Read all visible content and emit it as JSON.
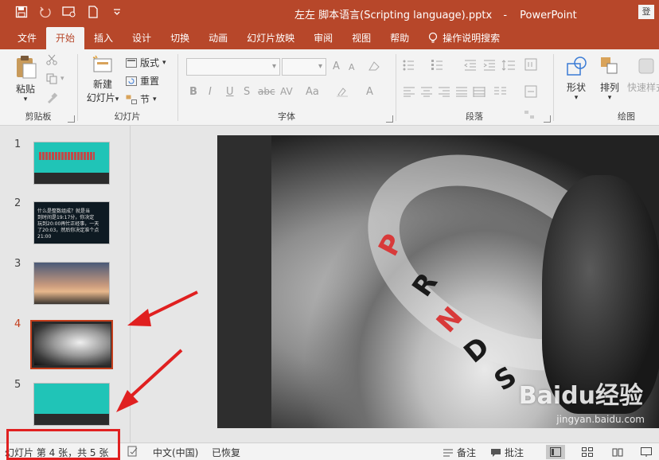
{
  "titlebar": {
    "document": "左左 脚本语言(Scripting language).pptx",
    "separator": "-",
    "app": "PowerPoint",
    "login": "登"
  },
  "qat": [
    "save-icon",
    "undo-icon",
    "presentation-icon",
    "new-file-icon",
    "customize-icon"
  ],
  "tabs": [
    {
      "label": "文件",
      "active": false
    },
    {
      "label": "开始",
      "active": true
    },
    {
      "label": "插入",
      "active": false
    },
    {
      "label": "设计",
      "active": false
    },
    {
      "label": "切换",
      "active": false
    },
    {
      "label": "动画",
      "active": false
    },
    {
      "label": "幻灯片放映",
      "active": false
    },
    {
      "label": "审阅",
      "active": false
    },
    {
      "label": "视图",
      "active": false
    },
    {
      "label": "帮助",
      "active": false
    }
  ],
  "tell_me": "操作说明搜索",
  "ribbon": {
    "clipboard": {
      "label": "剪贴板",
      "paste": "粘贴"
    },
    "slides": {
      "label": "幻灯片",
      "new_slide_line1": "新建",
      "new_slide_line2": "幻灯片",
      "layout": "版式",
      "reset": "重置",
      "section": "节"
    },
    "font": {
      "label": "字体",
      "bold": "B",
      "italic": "I",
      "underline": "U",
      "strike": "S",
      "shadow": "abc",
      "spacing": "AV",
      "case": "Aa",
      "grow": "A",
      "shrink": "A",
      "color": "A"
    },
    "paragraph": {
      "label": "段落"
    },
    "drawing": {
      "label": "绘图",
      "shapes": "形状",
      "arrange": "排列",
      "quick_styles": "快速样式"
    }
  },
  "thumbnails": [
    {
      "number": "1",
      "active": false
    },
    {
      "number": "2",
      "active": false,
      "text": "什么是整数组成？就是当\n到时间是19:17分，你决定\n玩到20:00再忙正经事，一天\n了20:03，然后你决定准个点\n21:00"
    },
    {
      "number": "3",
      "active": false
    },
    {
      "number": "4",
      "active": true
    },
    {
      "number": "5",
      "active": false
    }
  ],
  "slide": {
    "gears": [
      "P",
      "R",
      "N",
      "D",
      "S"
    ]
  },
  "watermark": {
    "brand": "Baidu经验",
    "url": "jingyan.baidu.com"
  },
  "statusbar": {
    "slide_info": "幻灯片 第 4 张，共 5 张",
    "language": "中文(中国)",
    "recovered": "已恢复",
    "notes": "备注",
    "comments": "批注"
  },
  "colors": {
    "brand": "#b7472a",
    "active_thumb": "#c43e1c",
    "annotation_red": "#e02020"
  }
}
